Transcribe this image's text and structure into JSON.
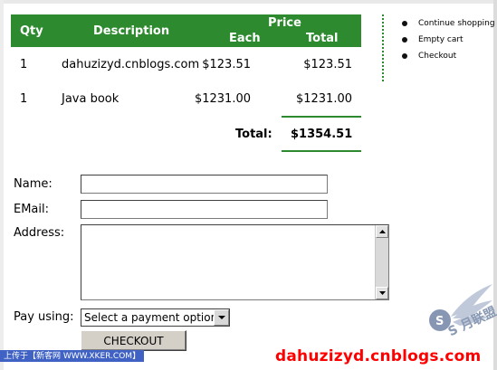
{
  "cart": {
    "headers": {
      "qty": "Qty",
      "description": "Description",
      "price": "Price",
      "each": "Each",
      "total": "Total"
    },
    "items": [
      {
        "qty": "1",
        "description": "dahuzizyd.cnblogs.com",
        "each": "$123.51",
        "total": "$123.51"
      },
      {
        "qty": "1",
        "description": "Java book",
        "each": "$1231.00",
        "total": "$1231.00"
      }
    ],
    "total_label": "Total:",
    "total_value": "$1354.51"
  },
  "side_menu": {
    "items": [
      "Continue shopping",
      "Empty cart",
      "Checkout"
    ]
  },
  "form": {
    "name_label": "Name:",
    "name_value": "",
    "email_label": "EMail:",
    "email_value": "",
    "address_label": "Address:",
    "address_value": "",
    "pay_label": "Pay using:",
    "pay_selected": "Select a payment option",
    "checkout_label": "CHECKOUT"
  },
  "watermarks": {
    "badge": "上传于【新客网 WWW.XKER.COM】",
    "url": "dahuzizyd.cnblogs.com",
    "logo": "S 月联盟"
  },
  "colors": {
    "accent_green": "#2d8a2f",
    "watermark_red": "#ff0000",
    "badge_blue": "#3f62c4"
  }
}
